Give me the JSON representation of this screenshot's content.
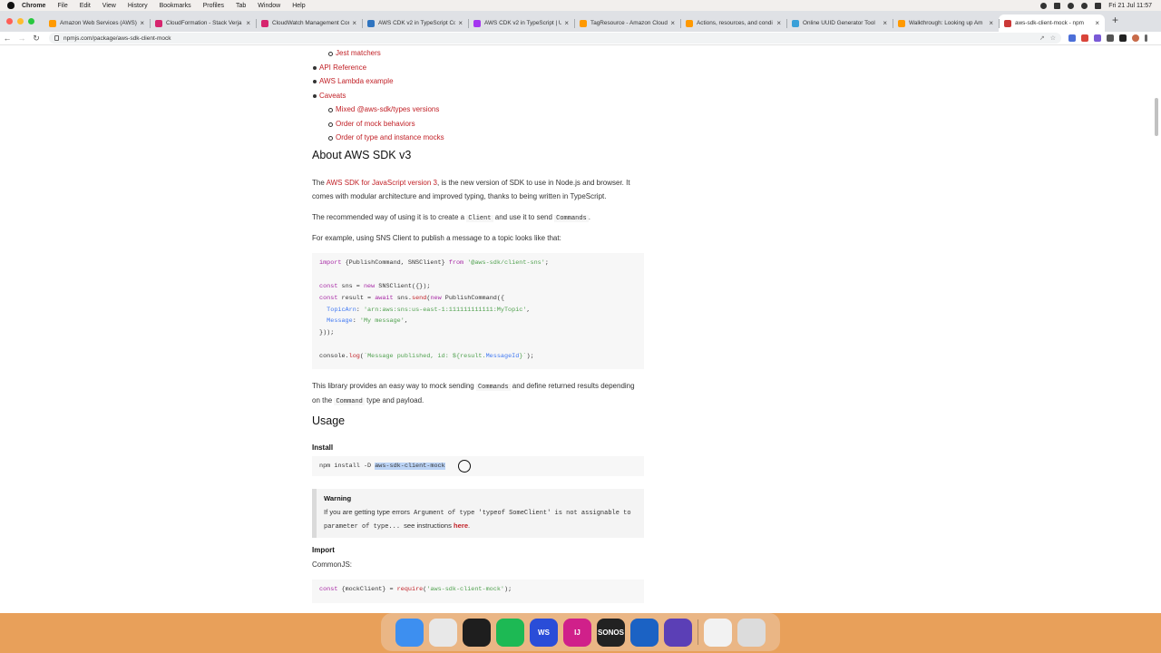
{
  "menubar": {
    "app": "Chrome",
    "menus": [
      "File",
      "Edit",
      "View",
      "History",
      "Bookmarks",
      "Profiles",
      "Tab",
      "Window",
      "Help"
    ],
    "clock": "Fri 21 Jul  11:57"
  },
  "tabs": [
    {
      "title": "Amazon Web Services (AWS)",
      "color": "#ff9900"
    },
    {
      "title": "CloudFormation - Stack Verja",
      "color": "#d6246e"
    },
    {
      "title": "CloudWatch Management Cons",
      "color": "#d6246e"
    },
    {
      "title": "AWS CDK v2 in TypeScript Co",
      "color": "#2f74c0"
    },
    {
      "title": "AWS CDK v2 in TypeScript | U",
      "color": "#a435f0"
    },
    {
      "title": "TagResource - Amazon Cloud",
      "color": "#ff9900"
    },
    {
      "title": "Actions, resources, and condi",
      "color": "#ff9900"
    },
    {
      "title": "Online UUID Generator Tool",
      "color": "#3aa0d8"
    },
    {
      "title": "Walkthrough: Looking up Am",
      "color": "#ff9900"
    },
    {
      "title": "aws-sdk-client-mock - npm",
      "color": "#cb3837",
      "active": true
    }
  ],
  "address": {
    "url": "npmjs.com/package/aws-sdk-client-mock"
  },
  "toc": [
    {
      "label": "Jest matchers",
      "level": 2
    },
    {
      "label": "API Reference",
      "level": 1
    },
    {
      "label": "AWS Lambda example",
      "level": 1
    },
    {
      "label": "Caveats",
      "level": 1
    },
    {
      "label": "Mixed @aws-sdk/types versions",
      "level": 2
    },
    {
      "label": "Order of mock behaviors",
      "level": 2
    },
    {
      "label": "Order of type and instance mocks",
      "level": 2
    }
  ],
  "about": {
    "heading": "About AWS SDK v3",
    "p1_pre": "The ",
    "p1_link": "AWS SDK for JavaScript version 3",
    "p1_post": ", is the new version of SDK to use in Node.js and browser. It comes with modular architecture and improved typing, thanks to being written in TypeScript.",
    "p2_a": "The recommended way of using it is to create a ",
    "p2_code1": "Client",
    "p2_b": " and use it to send ",
    "p2_code2": "Commands",
    "p2_c": ".",
    "p3": "For example, using SNS Client to publish a message to a topic looks like that:",
    "code": {
      "l1_kw": "import",
      "l1_mid": " {PublishCommand, SNSClient} ",
      "l1_from": "from",
      "l1_str": " '@aws-sdk/client-sns'",
      "l1_end": ";",
      "l3_kw": "const",
      "l3_mid": " sns = ",
      "l3_new": "new",
      "l3_end": " SNSClient({});",
      "l4_kw": "const",
      "l4_mid": " result = ",
      "l4_await": "await",
      "l4_b": " sns.",
      "l4_send": "send",
      "l4_c": "(",
      "l4_new": "new",
      "l4_d": " PublishCommand({",
      "l5_prop": "  TopicArn",
      "l5_rest": ": ",
      "l5_str": "'arn:aws:sns:us-east-1:111111111111:MyTopic'",
      "l5_end": ",",
      "l6_prop": "  Message",
      "l6_rest": ": ",
      "l6_str": "'My message'",
      "l6_end": ",",
      "l7": "}));",
      "l9_a": "console.",
      "l9_log": "log",
      "l9_b": "(",
      "l9_str1": "`Message published, id: ${result.",
      "l9_prop": "MessageId",
      "l9_str2": "}`",
      "l9_end": ");"
    },
    "p4_a": "This library provides an easy way to mock sending ",
    "p4_code1": "Commands",
    "p4_b": " and define returned results depending on the ",
    "p4_code2": "Command",
    "p4_c": " type and payload."
  },
  "usage": {
    "heading": "Usage",
    "install_heading": "Install",
    "install_cmd": "npm install -D ",
    "install_pkg": "aws-sdk-client-mock",
    "warning": {
      "title": "Warning",
      "a": "If you are getting type errors ",
      "code1": "Argument of type 'typeof SomeClient' is not assignable to parameter of type...",
      "b": " see instructions ",
      "link": "here",
      "c": "."
    },
    "import_heading": "Import",
    "commonjs": "CommonJS:",
    "import_code": {
      "kw": "const",
      "mid": " {mockClient} = ",
      "req": "require",
      "b": "(",
      "str": "'aws-sdk-client-mock'",
      "end": ");"
    }
  },
  "dock": [
    {
      "name": "Finder",
      "color": "#3d8ff0",
      "label": ""
    },
    {
      "name": "Chrome",
      "color": "#e8e8e8",
      "label": ""
    },
    {
      "name": "Terminal",
      "color": "#1e1e1e",
      "label": ""
    },
    {
      "name": "Spotify",
      "color": "#1db954",
      "label": ""
    },
    {
      "name": "WebStorm",
      "color": "#2a4dd8",
      "label": "WS"
    },
    {
      "name": "IntelliJ",
      "color": "#d0208a",
      "label": "IJ"
    },
    {
      "name": "Sonos",
      "color": "#222222",
      "label": "SONOS"
    },
    {
      "name": "Proxyman",
      "color": "#1b62c4",
      "label": ""
    },
    {
      "name": "Instruments",
      "color": "#5b3fb6",
      "label": ""
    },
    {
      "name": "Documents",
      "color": "#f2f2f2",
      "label": ""
    },
    {
      "name": "Trash",
      "color": "#dcdcdc",
      "label": ""
    }
  ]
}
